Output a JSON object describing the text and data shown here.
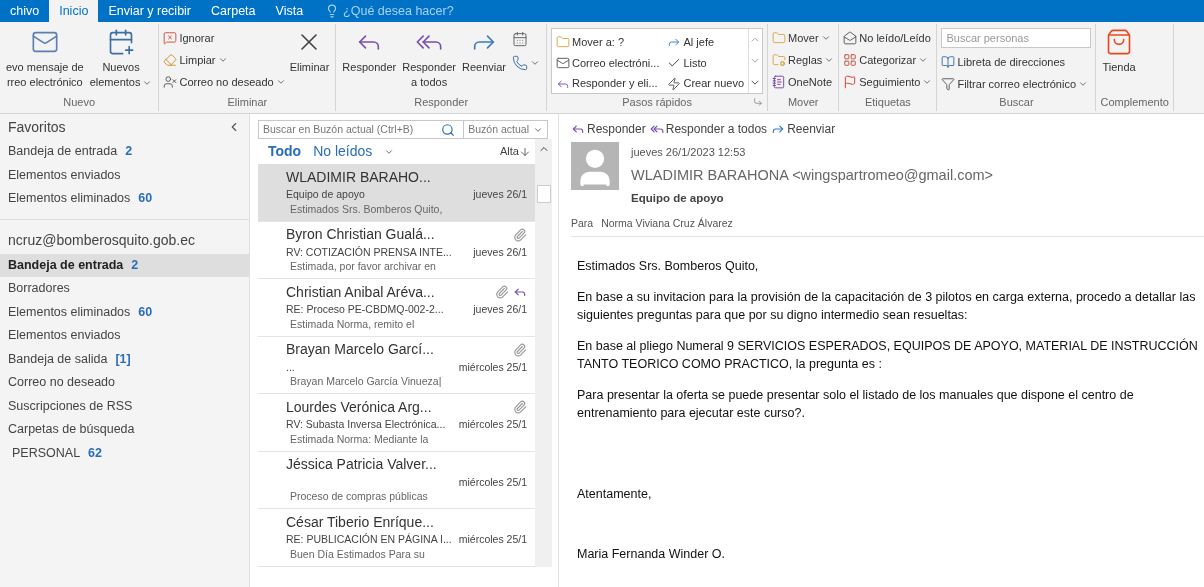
{
  "menu_tabs": [
    {
      "label": "chivo",
      "selected": false
    },
    {
      "label": "Inicio",
      "selected": true
    },
    {
      "label": "Enviar y recibir",
      "selected": false
    },
    {
      "label": "Carpeta",
      "selected": false
    },
    {
      "label": "Vista",
      "selected": false
    }
  ],
  "tell_me": "¿Qué desea hacer?",
  "ribbon": {
    "groups": [
      {
        "label": "Nuevo",
        "columns": [
          [
            {
              "kind": "large",
              "lines": [
                "evo mensaje de",
                "rreo electrónico"
              ],
              "dropdown": false
            }
          ],
          [
            {
              "kind": "large",
              "lines": [
                "Nuevos",
                "elementos"
              ],
              "dropdown": true
            }
          ]
        ]
      },
      {
        "label": "Eliminar",
        "columns": [
          [
            {
              "kind": "small",
              "label": "Ignorar",
              "dropdown": false
            },
            {
              "kind": "small",
              "label": "Limpiar",
              "dropdown": true
            },
            {
              "kind": "small",
              "label": "Correo no deseado",
              "dropdown": true
            }
          ],
          [
            {
              "kind": "large",
              "lines": [
                "Eliminar"
              ],
              "dropdown": false
            }
          ]
        ]
      },
      {
        "label": "Responder",
        "columns": [
          [
            {
              "kind": "large",
              "lines": [
                "Responder"
              ],
              "dropdown": false
            }
          ],
          [
            {
              "kind": "large",
              "lines": [
                "Responder",
                "a todos"
              ],
              "dropdown": false
            }
          ],
          [
            {
              "kind": "large",
              "lines": [
                "Reenviar"
              ],
              "dropdown": false
            }
          ],
          [
            {
              "kind": "icon",
              "dropdown": false
            },
            {
              "kind": "icon",
              "dropdown": true
            }
          ]
        ]
      },
      {
        "label": "Pasos rápidos",
        "launcher": true,
        "gallery": true,
        "columns": [
          [
            {
              "kind": "small",
              "label": "Mover a: ?",
              "dropdown": false
            },
            {
              "kind": "small",
              "label": "Correo electróni...",
              "dropdown": false
            },
            {
              "kind": "small",
              "label": "Responder y eli...",
              "dropdown": false
            }
          ],
          [
            {
              "kind": "small",
              "label": "Al jefe",
              "dropdown": false
            },
            {
              "kind": "small",
              "label": "Listo",
              "dropdown": false
            },
            {
              "kind": "small",
              "label": "Crear nuevo",
              "dropdown": false
            }
          ]
        ]
      },
      {
        "label": "Mover",
        "columns": [
          [
            {
              "kind": "small",
              "label": "Mover",
              "dropdown": true
            },
            {
              "kind": "small",
              "label": "Reglas",
              "dropdown": true
            },
            {
              "kind": "small",
              "label": "OneNote",
              "dropdown": false
            }
          ]
        ]
      },
      {
        "label": "Etiquetas",
        "columns": [
          [
            {
              "kind": "small",
              "label": "No leído/Leído",
              "dropdown": false
            },
            {
              "kind": "small",
              "label": "Categorizar",
              "dropdown": true
            },
            {
              "kind": "small",
              "label": "Seguimiento",
              "dropdown": true
            }
          ]
        ]
      },
      {
        "label": "Buscar",
        "columns": [
          [
            {
              "kind": "field",
              "placeholder": "Buscar personas"
            },
            {
              "kind": "small",
              "label": "Libreta de direcciones",
              "dropdown": false
            },
            {
              "kind": "small",
              "label": "Filtrar correo electrónico",
              "dropdown": true
            }
          ]
        ]
      },
      {
        "label": "Complemento",
        "columns": [
          [
            {
              "kind": "large",
              "lines": [
                "Tienda"
              ],
              "dropdown": false
            }
          ]
        ]
      }
    ]
  },
  "folders": {
    "favorites": {
      "title": "Favoritos",
      "items": [
        {
          "label": "Bandeja de entrada",
          "count": "2",
          "selected": false
        },
        {
          "label": "Elementos enviados",
          "selected": false
        },
        {
          "label": "Elementos eliminados",
          "count": "60",
          "selected": false
        }
      ]
    },
    "account": {
      "title": "ncruz@bomberosquito.gob.ec",
      "items": [
        {
          "label": "Bandeja de entrada",
          "count": "2",
          "selected": true
        },
        {
          "label": "Borradores",
          "selected": false
        },
        {
          "label": "Elementos eliminados",
          "count": "60",
          "selected": false
        },
        {
          "label": "Elementos enviados",
          "selected": false
        },
        {
          "label": "Bandeja de salida",
          "count": "[1]",
          "selected": false
        },
        {
          "label": "Correo no deseado",
          "selected": false
        },
        {
          "label": "Suscripciones de RSS",
          "selected": false
        },
        {
          "label": "Carpetas de búsqueda",
          "selected": false,
          "children": [
            {
              "label": "PERSONAL",
              "count": "62",
              "selected": false
            }
          ]
        }
      ]
    }
  },
  "message_list": {
    "search": {
      "placeholder": "Buscar en Buzón actual (Ctrl+B)",
      "scope": "Buzón actual"
    },
    "filters": [
      {
        "label": "Todo",
        "selected": true
      },
      {
        "label": "No leídos",
        "selected": false
      }
    ],
    "sort": "Alta",
    "messages": [
      {
        "sender": "WLADIMIR BARAHO...",
        "subject": "Equipo de apoyo",
        "date": "jueves 26/1",
        "preview": "Estimados Srs. Bomberos Quito,",
        "attachment": false,
        "replied": false,
        "selected": true
      },
      {
        "sender": "Byron Christian Gualá...",
        "subject": "RV: COTIZACIÓN PRENSA INTE...",
        "date": "jueves 26/1",
        "preview": "Estimada, por favor archivar en",
        "attachment": true,
        "replied": false,
        "selected": false
      },
      {
        "sender": "Christian Anibal Aréva...",
        "subject": "RE: Proceso PE-CBDMQ-002-2...",
        "date": "jueves 26/1",
        "preview": "Estimada Norma, remito el",
        "attachment": true,
        "replied": true,
        "selected": false
      },
      {
        "sender": "Brayan Marcelo Garcí...",
        "subject": "...",
        "date": "miércoles 25/1",
        "preview": "Brayan Marcelo García Vinueza|",
        "attachment": true,
        "replied": false,
        "selected": false
      },
      {
        "sender": "Lourdes Verónica Arg...",
        "subject": "RV: Subasta Inversa Electrónica...",
        "date": "miércoles 25/1",
        "preview": "Estimada Norma:  Mediante la",
        "attachment": true,
        "replied": false,
        "selected": false
      },
      {
        "sender": "Jéssica Patricia Valver...",
        "date": "miércoles 25/1",
        "preview": "Proceso de compras públicas",
        "attachment": false,
        "replied": false,
        "selected": false
      },
      {
        "sender": "César Tiberio Enríque...",
        "subject": "RE: PUBLICACIÓN EN PÁGINA I...",
        "date": "miércoles 25/1",
        "preview": "Buen Día  Estimados  Para su",
        "attachment": false,
        "replied": false,
        "selected": false
      }
    ]
  },
  "reading_pane": {
    "actions": [
      "Responder",
      "Responder a todos",
      "Reenviar"
    ],
    "date": "jueves 26/1/2023 12:53",
    "from": "WLADIMIR BARAHONA <wingspartromeo@gmail.com>",
    "subject": "Equipo de apoyo",
    "to_label": "Para",
    "to": "Norma Viviana Cruz Álvarez",
    "body": [
      {
        "kind": "paragraph",
        "text": "Estimados Srs. Bomberos Quito,"
      },
      {
        "kind": "paragraph",
        "text": "En base a su invitacion para la provisión de la capacitación de 3 pilotos en carga externa, procedo a detallar las siguientes preguntas para que por su digno intermedio sean resueltas:"
      },
      {
        "kind": "paragraph",
        "text": "En base al pliego Numeral 9 SERVICIOS ESPERADOS, EQUIPOS DE APOYO, MATERIAL DE INSTRUCCIÓN TANTO TEORICO COMO PRACTICO,  la pregunta es :"
      },
      {
        "kind": "paragraph",
        "text": "Para presentar la oferta se puede presentar solo el listado de los manuales que dispone el centro de entrenamiento para ejecutar este curso?."
      },
      {
        "kind": "closing",
        "text": "Atentamente,"
      },
      {
        "kind": "signature",
        "text": "Maria Fernanda Winder O."
      }
    ]
  }
}
